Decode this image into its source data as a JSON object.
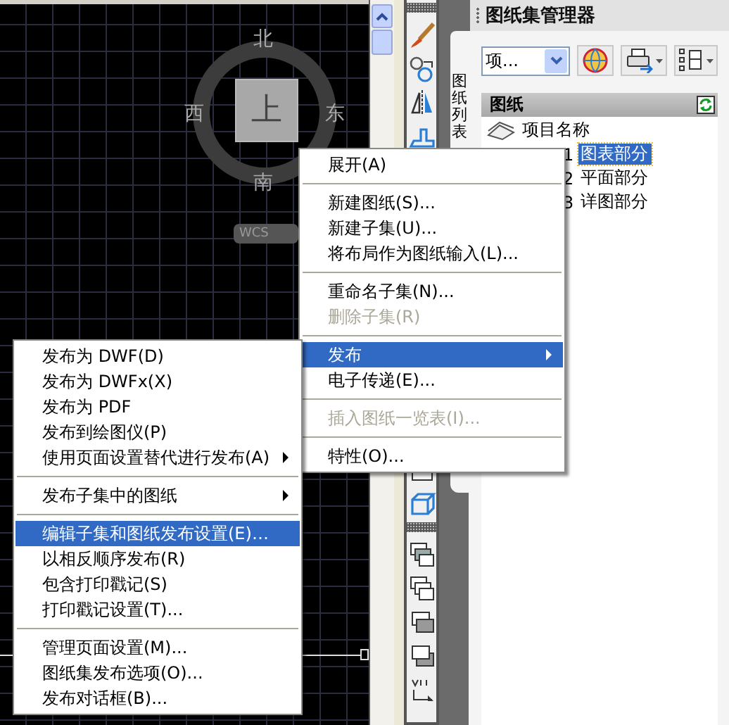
{
  "viewcube": {
    "north": "北",
    "west": "西",
    "east": "东",
    "south": "南",
    "top_face": "上",
    "ucs_menu": "WCS"
  },
  "sheet_set_manager": {
    "title": "图纸集管理器",
    "tab": "图纸列表",
    "view_selector": {
      "value": "项..."
    },
    "sheets_header": "图纸",
    "tree": [
      {
        "label": "项目名称",
        "selected": false,
        "children": [
          {
            "number": "1",
            "label": "图表部分",
            "selected": true
          },
          {
            "number": "2",
            "label": "平面部分",
            "selected": false
          },
          {
            "number": "3",
            "label": "详图部分",
            "selected": false
          }
        ]
      }
    ]
  },
  "context_menu": {
    "items": [
      {
        "kind": "item",
        "label": "展开(A)",
        "disabled": false,
        "selected": false,
        "submenu": false
      },
      {
        "kind": "separator"
      },
      {
        "kind": "item",
        "label": "新建图纸(S)...",
        "disabled": false,
        "selected": false,
        "submenu": false
      },
      {
        "kind": "item",
        "label": "新建子集(U)...",
        "disabled": false,
        "selected": false,
        "submenu": false
      },
      {
        "kind": "item",
        "label": "将布局作为图纸输入(L)...",
        "disabled": false,
        "selected": false,
        "submenu": false
      },
      {
        "kind": "separator"
      },
      {
        "kind": "item",
        "label": "重命名子集(N)...",
        "disabled": false,
        "selected": false,
        "submenu": false
      },
      {
        "kind": "item",
        "label": "删除子集(R)",
        "disabled": true,
        "selected": false,
        "submenu": false
      },
      {
        "kind": "separator"
      },
      {
        "kind": "item",
        "label": "发布",
        "disabled": false,
        "selected": true,
        "submenu": true
      },
      {
        "kind": "item",
        "label": "电子传递(E)...",
        "disabled": false,
        "selected": false,
        "submenu": false
      },
      {
        "kind": "separator"
      },
      {
        "kind": "item",
        "label": "插入图纸一览表(I)...",
        "disabled": true,
        "selected": false,
        "submenu": false
      },
      {
        "kind": "separator"
      },
      {
        "kind": "item",
        "label": "特性(O)...",
        "disabled": false,
        "selected": false,
        "submenu": false
      }
    ]
  },
  "publish_submenu": {
    "items": [
      {
        "kind": "item",
        "label": "发布为 DWF(D)",
        "disabled": false,
        "selected": false,
        "submenu": false
      },
      {
        "kind": "item",
        "label": "发布为 DWFx(X)",
        "disabled": false,
        "selected": false,
        "submenu": false
      },
      {
        "kind": "item",
        "label": "发布为 PDF",
        "disabled": false,
        "selected": false,
        "submenu": false
      },
      {
        "kind": "item",
        "label": "发布到绘图仪(P)",
        "disabled": false,
        "selected": false,
        "submenu": false
      },
      {
        "kind": "item",
        "label": "使用页面设置替代进行发布(A)",
        "disabled": false,
        "selected": false,
        "submenu": true
      },
      {
        "kind": "separator"
      },
      {
        "kind": "item",
        "label": "发布子集中的图纸",
        "disabled": false,
        "selected": false,
        "submenu": true
      },
      {
        "kind": "separator"
      },
      {
        "kind": "item",
        "label": "编辑子集和图纸发布设置(E)…",
        "disabled": false,
        "selected": true,
        "submenu": false
      },
      {
        "kind": "item",
        "label": "以相反顺序发布(R)",
        "disabled": false,
        "selected": false,
        "submenu": false
      },
      {
        "kind": "item",
        "label": "包含打印戳记(S)",
        "disabled": false,
        "selected": false,
        "submenu": false
      },
      {
        "kind": "item",
        "label": "打印戳记设置(T)...",
        "disabled": false,
        "selected": false,
        "submenu": false
      },
      {
        "kind": "separator"
      },
      {
        "kind": "item",
        "label": "管理页面设置(M)...",
        "disabled": false,
        "selected": false,
        "submenu": false
      },
      {
        "kind": "item",
        "label": "图纸集发布选项(O)...",
        "disabled": false,
        "selected": false,
        "submenu": false
      },
      {
        "kind": "item",
        "label": "发布对话框(B)...",
        "disabled": false,
        "selected": false,
        "submenu": false
      }
    ]
  }
}
